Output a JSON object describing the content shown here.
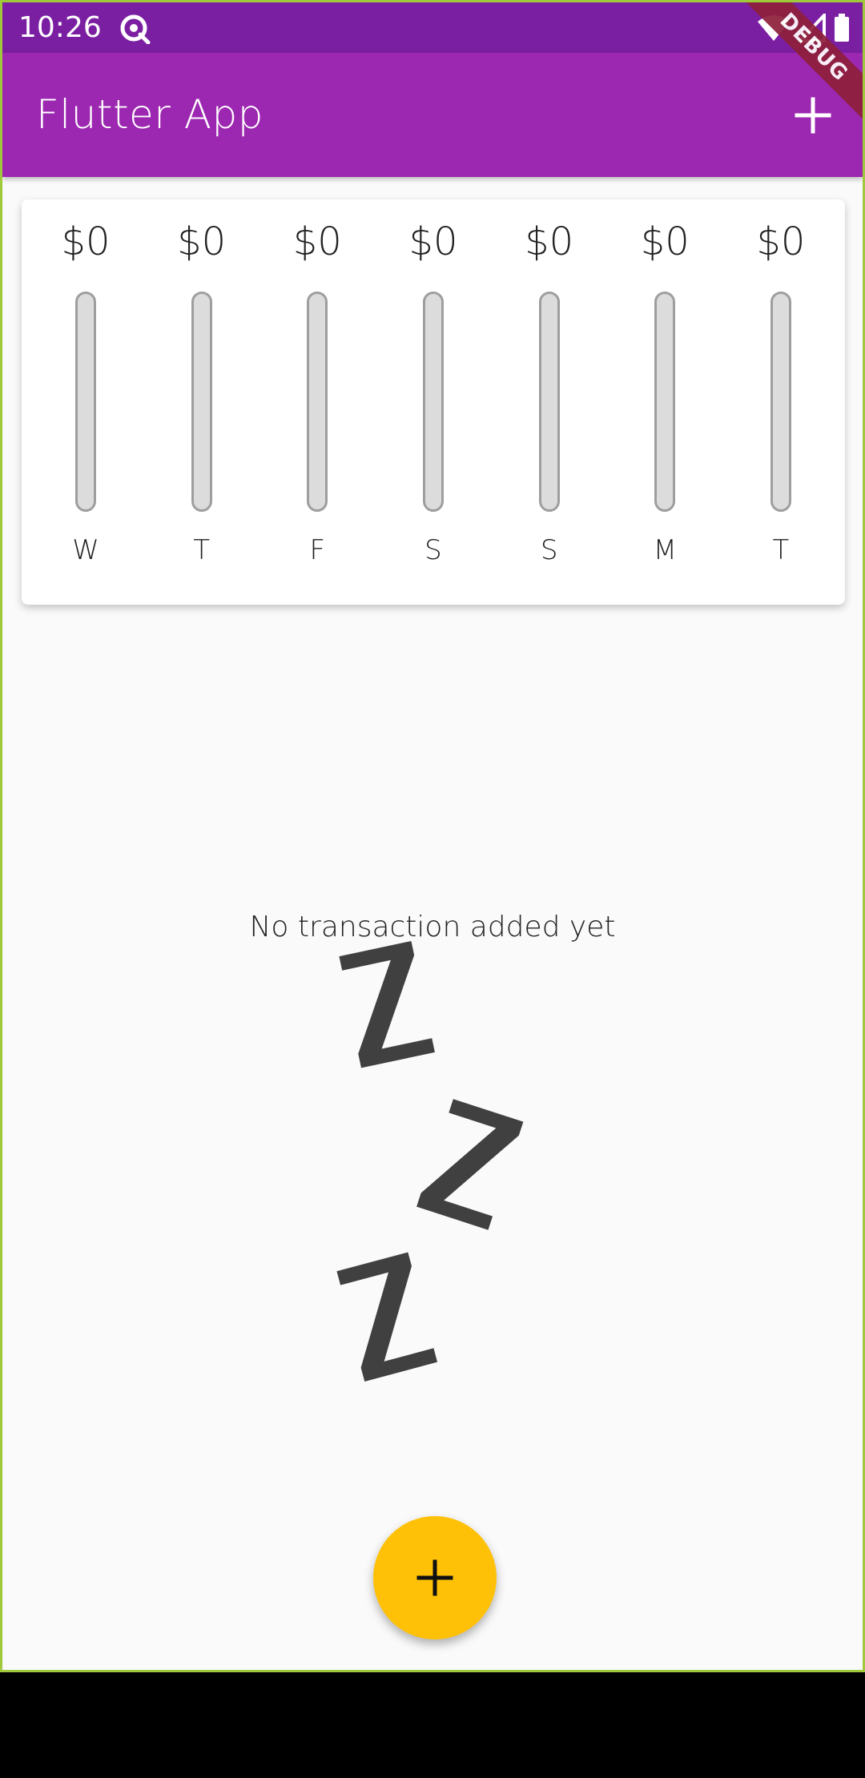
{
  "status_bar": {
    "time": "10:26",
    "icons": [
      "notification-icon",
      "wifi-icon",
      "signal-icon",
      "battery-icon"
    ],
    "color": "#7b1fa2"
  },
  "app_bar": {
    "title": "Flutter App",
    "action_icon": "add-icon",
    "color": "#9c27b0",
    "debug_banner": "DEBUG"
  },
  "weekly_chart": {
    "bars": [
      {
        "amount": "$0",
        "day": "W",
        "fill_fraction": 0
      },
      {
        "amount": "$0",
        "day": "T",
        "fill_fraction": 0
      },
      {
        "amount": "$0",
        "day": "F",
        "fill_fraction": 0
      },
      {
        "amount": "$0",
        "day": "S",
        "fill_fraction": 0
      },
      {
        "amount": "$0",
        "day": "S",
        "fill_fraction": 0
      },
      {
        "amount": "$0",
        "day": "M",
        "fill_fraction": 0
      },
      {
        "amount": "$0",
        "day": "T",
        "fill_fraction": 0
      }
    ]
  },
  "empty_state": {
    "message": "No transaction added yet",
    "illustration": "sleeping-zzz-icon"
  },
  "fab": {
    "icon": "add-icon",
    "color": "#ffc107"
  }
}
